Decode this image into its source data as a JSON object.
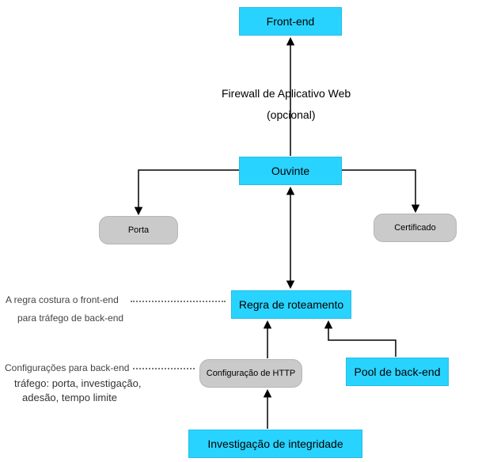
{
  "nodes": {
    "frontEnd": {
      "label": "Front-end"
    },
    "listener": {
      "label": "Ouvinte"
    },
    "port": {
      "label": "Porta"
    },
    "certificate": {
      "label": "Certificado"
    },
    "routingRule": {
      "label": "Regra de roteamento"
    },
    "httpSetting": {
      "label": "Configuração de HTTP"
    },
    "backendPool": {
      "label": "Pool de back-end"
    },
    "healthProbe": {
      "label": "Investigação de integridade"
    }
  },
  "labels": {
    "firewallLine1": "Firewall de Aplicativo Web",
    "firewallLine2": "(opcional)",
    "ruleNote1": "A regra costura o front-end",
    "ruleNote2": "para tráfego de back-end",
    "httpNote1": "Configurações para back-end",
    "httpNote2": "tráfego: porta, investigação,",
    "httpNote3": "adesão, tempo limite"
  }
}
